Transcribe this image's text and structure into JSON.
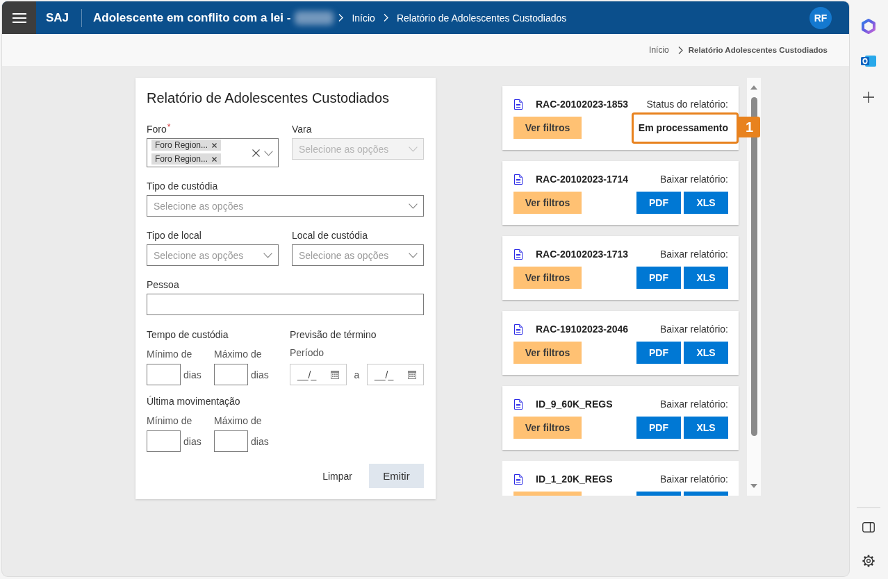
{
  "header": {
    "app_name": "SAJ",
    "title": "Adolescente em conflito com a lei -",
    "breadcrumb": [
      "Início",
      "Relatório de Adolescentes Custodiados"
    ],
    "user_initials": "RF"
  },
  "sub_header": {
    "breadcrumb": [
      "Início",
      "Relatório Adolescentes Custodiados"
    ]
  },
  "form": {
    "title": "Relatório de Adolescentes Custodiados",
    "rows": [
      [
        {
          "kind": "multiselect",
          "label": "Foro",
          "required_mark": "*",
          "chips": [
            "Foro Region...",
            "Foro Region..."
          ],
          "disabled": false
        },
        {
          "kind": "select",
          "label": "Vara",
          "placeholder": "Selecione as opções",
          "disabled": true
        }
      ],
      [
        {
          "kind": "select",
          "label": "Tipo de custódia",
          "placeholder": "Selecione as opções",
          "disabled": false
        }
      ],
      [
        {
          "kind": "select",
          "label": "Tipo de local",
          "placeholder": "Selecione as opções",
          "disabled": false
        },
        {
          "kind": "select",
          "label": "Local de custódia",
          "placeholder": "Selecione as opções",
          "disabled": false
        }
      ],
      [
        {
          "kind": "text",
          "label": "Pessoa",
          "disabled": false
        }
      ]
    ],
    "tempo_de_custodia": {
      "title": "Tempo de custódia",
      "inputs": [
        {
          "label": "Mínimo de",
          "unit": "dias"
        },
        {
          "label": "Máximo de",
          "unit": "dias"
        }
      ]
    },
    "previsao_de_termino": {
      "title": "Previsão de término",
      "period_label": "Período",
      "from_value": "__/_",
      "separator": "a",
      "to_value": "__/_"
    },
    "ultima_movimentacao": {
      "title": "Última movimentação",
      "inputs": [
        {
          "label": "Mínimo de",
          "unit": "dias"
        },
        {
          "label": "Máximo de",
          "unit": "dias"
        }
      ]
    },
    "buttons": [
      {
        "kind": "link",
        "label": "Limpar"
      },
      {
        "kind": "primary",
        "label": "Emitir"
      }
    ]
  },
  "reports": [
    {
      "kind": "processing",
      "name": "RAC-20102023-1853",
      "status_label": "Status do relatório:",
      "filter_button": "Ver filtros",
      "status_text": "Em processamento",
      "callout": "1"
    },
    {
      "kind": "ready",
      "name": "RAC-20102023-1714",
      "status_label": "Baixar relatório:",
      "filter_button": "Ver filtros",
      "downloads": [
        "PDF",
        "XLS"
      ]
    },
    {
      "kind": "ready",
      "name": "RAC-20102023-1713",
      "status_label": "Baixar relatório:",
      "filter_button": "Ver filtros",
      "downloads": [
        "PDF",
        "XLS"
      ]
    },
    {
      "kind": "ready",
      "name": "RAC-19102023-2046",
      "status_label": "Baixar relatório:",
      "filter_button": "Ver filtros",
      "downloads": [
        "PDF",
        "XLS"
      ]
    },
    {
      "kind": "ready",
      "name": "ID_9_60K_REGS",
      "status_label": "Baixar relatório:",
      "filter_button": "Ver filtros",
      "downloads": [
        "PDF",
        "XLS"
      ]
    },
    {
      "kind": "cut",
      "name": "ID_1_20K_REGS",
      "status_label": "Baixar relatório:"
    }
  ]
}
